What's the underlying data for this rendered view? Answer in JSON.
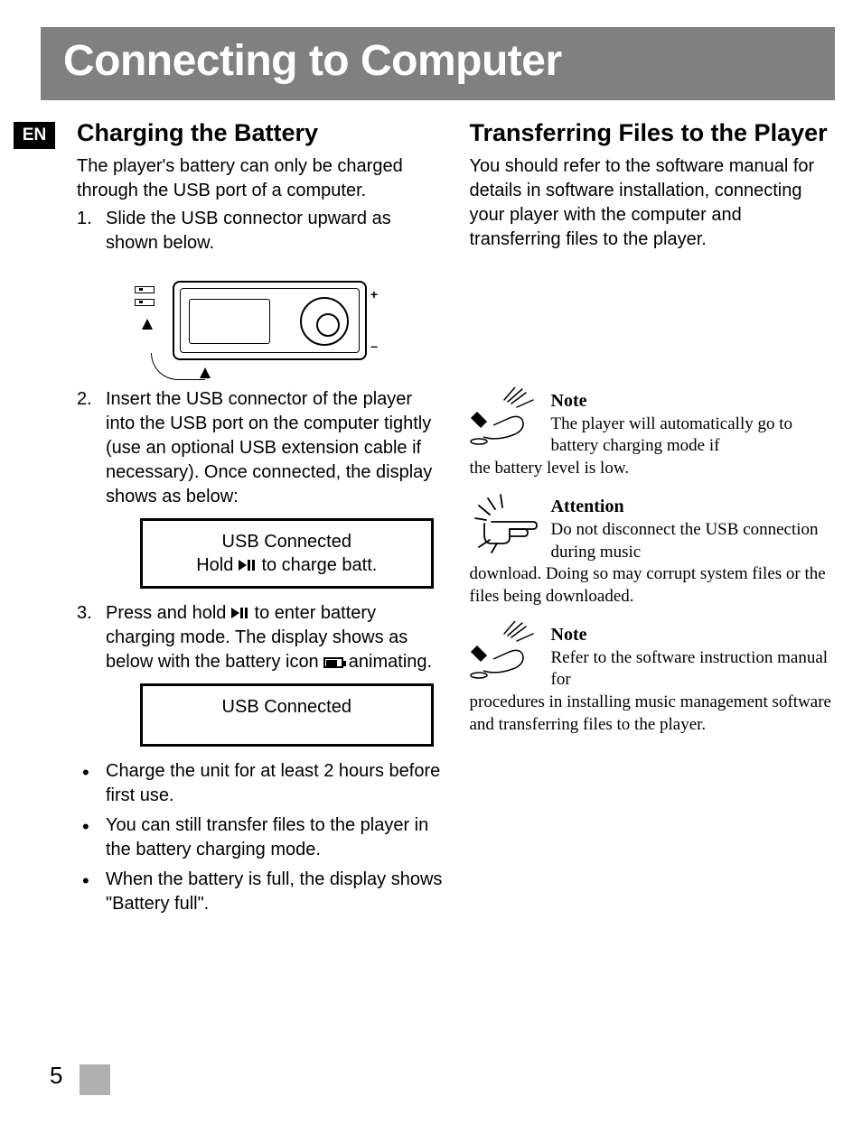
{
  "title": "Connecting to Computer",
  "lang_tag": "EN",
  "page_number": "5",
  "left": {
    "heading": "Charging the Battery",
    "intro": "The player's battery can only be charged through the USB port of a computer.",
    "step1": "Slide the USB connector upward as shown below.",
    "step2": "Insert the USB connector of the player into the USB port on the computer tightly (use an optional USB extension cable if necessary). Once connected, the display shows as below:",
    "display1_line1": "USB Connected",
    "display1_line2_pre": "Hold ",
    "display1_line2_post": " to charge batt.",
    "step3_pre": "Press and hold  ",
    "step3_mid": " to enter battery charging mode. The display shows as below with the battery icon  ",
    "step3_post": " animating.",
    "display2_line1": "USB Connected",
    "bullets": [
      "Charge the unit for at least 2 hours before first use.",
      "You can still transfer files to the player in the battery charging mode.",
      "When the battery is full, the display shows \"Battery full\"."
    ]
  },
  "right": {
    "heading": "Transferring Files to the Player",
    "intro": "You should refer to the software manual for details in software installation, connecting your player with the computer and transferring files  to the player.",
    "note1_head": "Note",
    "note1_body_a": "The player will automatically go to battery charging mode if",
    "note1_body_b": "the battery level is low.",
    "attn_head": "Attention",
    "attn_body_a": "Do not disconnect the USB connection during music",
    "attn_body_b": "download. Doing so may corrupt system files or the files being downloaded.",
    "note2_head": "Note",
    "note2_body_a": "Refer to the software instruction manual for",
    "note2_body_b": "procedures in installing music management software and transferring files to the player."
  }
}
